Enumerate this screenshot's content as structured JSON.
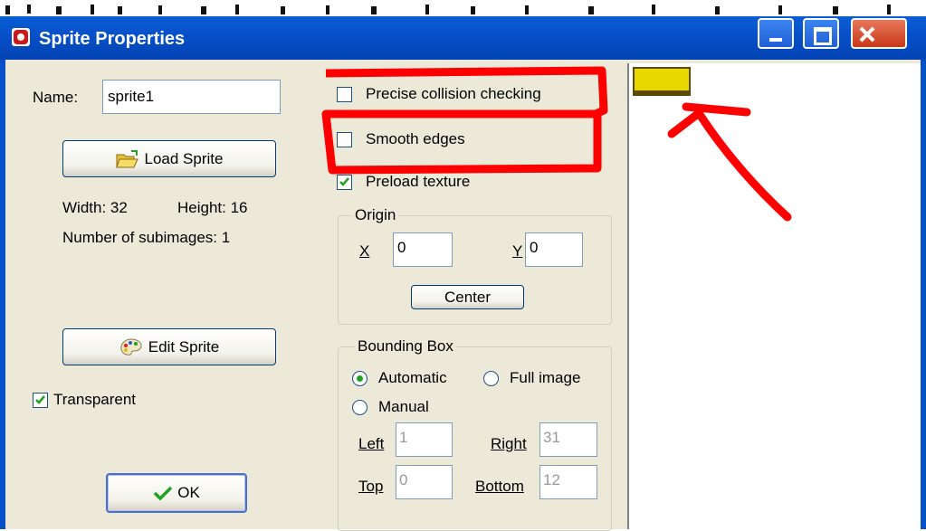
{
  "window": {
    "title": "Sprite Properties",
    "controls": [
      "minimize-icon",
      "maximize-icon",
      "close-icon"
    ]
  },
  "name_field": {
    "label": "Name:",
    "value": "sprite1"
  },
  "load_sprite": {
    "label": "Load Sprite",
    "icon": "folder-open-icon"
  },
  "info": {
    "width": "Width: 32",
    "height": "Height: 16",
    "subimages": "Number of subimages: 1"
  },
  "edit_sprite": {
    "label": "Edit Sprite",
    "icon": "palette-icon"
  },
  "transparent": {
    "label": "Transparent",
    "checked": true
  },
  "ok": {
    "label": "OK",
    "icon": "checkmark-icon"
  },
  "options": {
    "precise": {
      "label": "Precise collision checking",
      "checked": false
    },
    "smooth": {
      "label": "Smooth edges",
      "checked": false
    },
    "preload": {
      "label": "Preload texture",
      "checked": true
    }
  },
  "origin": {
    "title": "Origin",
    "x_label": "X",
    "x_value": "0",
    "y_label": "Y",
    "y_value": "0",
    "center_label": "Center"
  },
  "bbox": {
    "title": "Bounding Box",
    "automatic": "Automatic",
    "full_image": "Full image",
    "manual": "Manual",
    "selected": "Automatic",
    "left_label": "Left",
    "left_value": "1",
    "right_label": "Right",
    "right_value": "31",
    "top_label": "Top",
    "top_value": "0",
    "bottom_label": "Bottom",
    "bottom_value": "12"
  },
  "colors": {
    "titlebar": "#0650c8",
    "dialog_bg": "#ece9d8",
    "annotation": "#ff0000",
    "sprite_fill": "#e8d800"
  }
}
